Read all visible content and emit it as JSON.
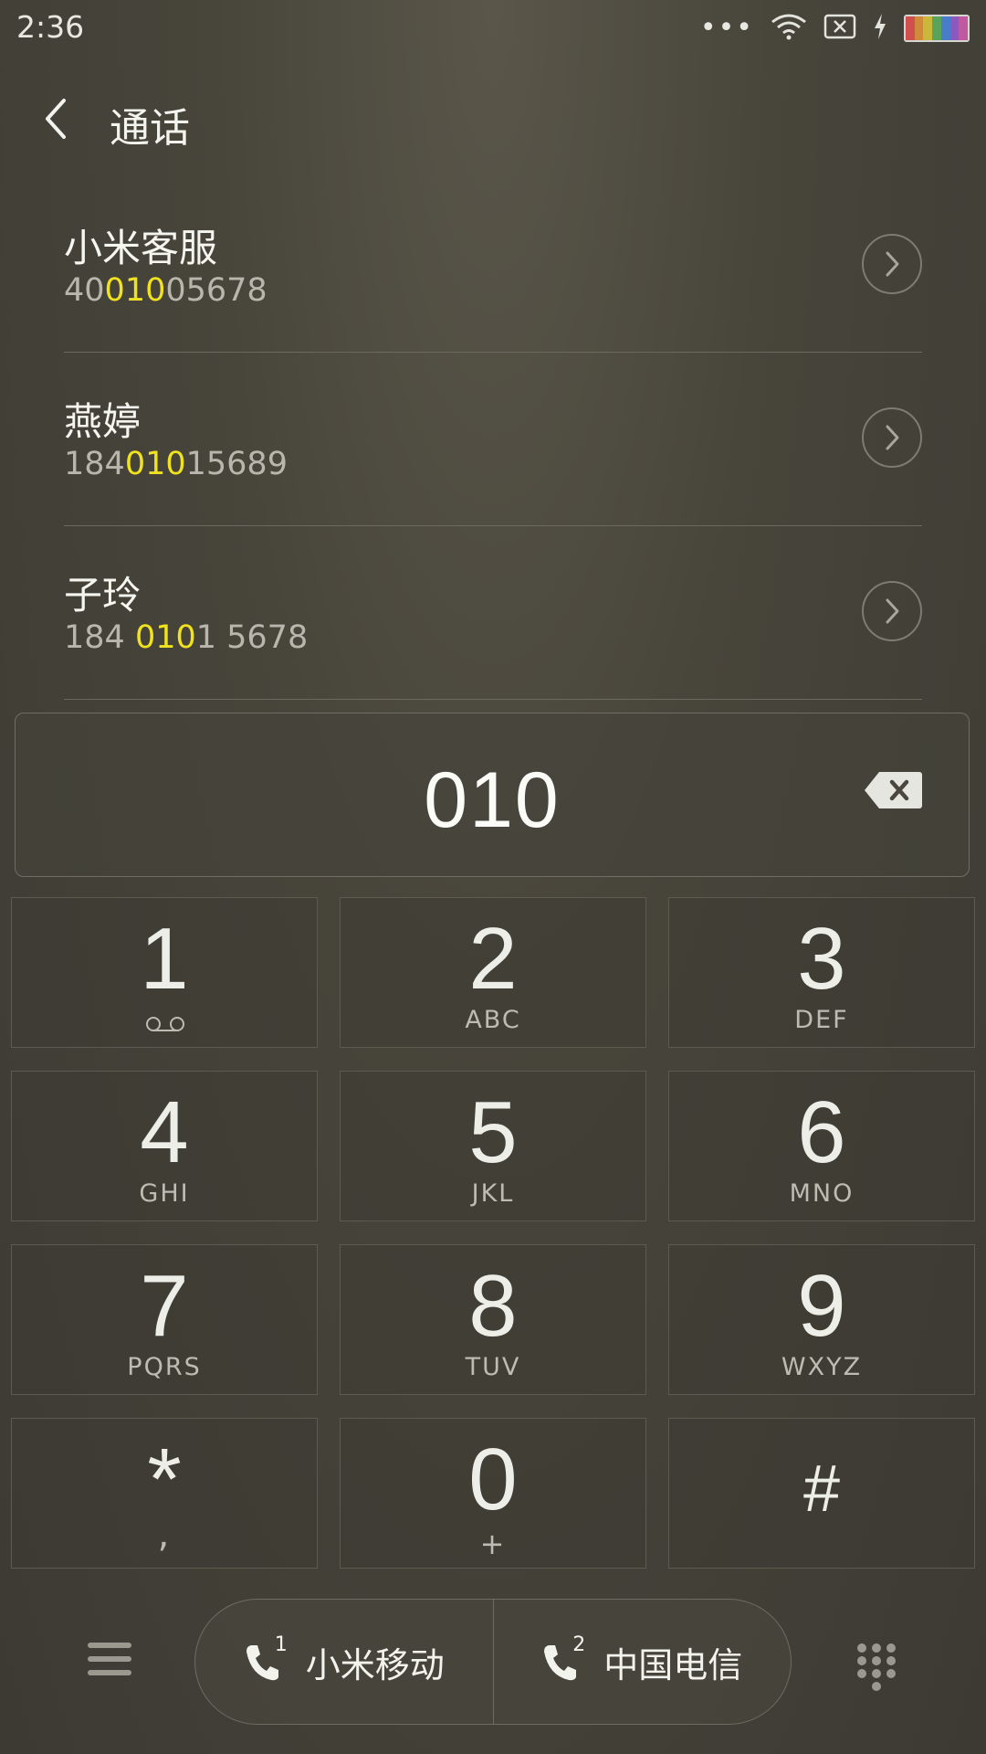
{
  "status_bar": {
    "time": "2:36",
    "icons": [
      "more-dots-icon",
      "wifi-icon",
      "no-sim-icon",
      "charging-icon",
      "battery-icon"
    ]
  },
  "header": {
    "title": "通话",
    "back_icon": "chevron-left-icon"
  },
  "contacts": [
    {
      "name": "小米客服",
      "number_pre": "40",
      "number_match": "010",
      "number_post": "05678"
    },
    {
      "name": "燕婷",
      "number_pre": "184",
      "number_match": "010",
      "number_post": "15689"
    },
    {
      "name": "子玲",
      "number_pre": "184 ",
      "number_match": "010",
      "number_post": "1 5678"
    }
  ],
  "display": {
    "value": "010",
    "backspace_icon": "backspace-icon"
  },
  "keypad": [
    {
      "digit": "1",
      "letters": ""
    },
    {
      "digit": "2",
      "letters": "ABC"
    },
    {
      "digit": "3",
      "letters": "DEF"
    },
    {
      "digit": "4",
      "letters": "GHI"
    },
    {
      "digit": "5",
      "letters": "JKL"
    },
    {
      "digit": "6",
      "letters": "MNO"
    },
    {
      "digit": "7",
      "letters": "PQRS"
    },
    {
      "digit": "8",
      "letters": "TUV"
    },
    {
      "digit": "9",
      "letters": "WXYZ"
    },
    {
      "digit": "*",
      "letters": ","
    },
    {
      "digit": "0",
      "letters": "+"
    },
    {
      "digit": "#",
      "letters": ""
    }
  ],
  "bottom_bar": {
    "menu_icon": "menu-icon",
    "sim1": {
      "num": "1",
      "label": "小米移动"
    },
    "sim2": {
      "num": "2",
      "label": "中国电信"
    },
    "dialpad_icon": "dialpad-icon"
  },
  "colors": {
    "highlight": "#f1e21f",
    "background": "#48453b"
  }
}
